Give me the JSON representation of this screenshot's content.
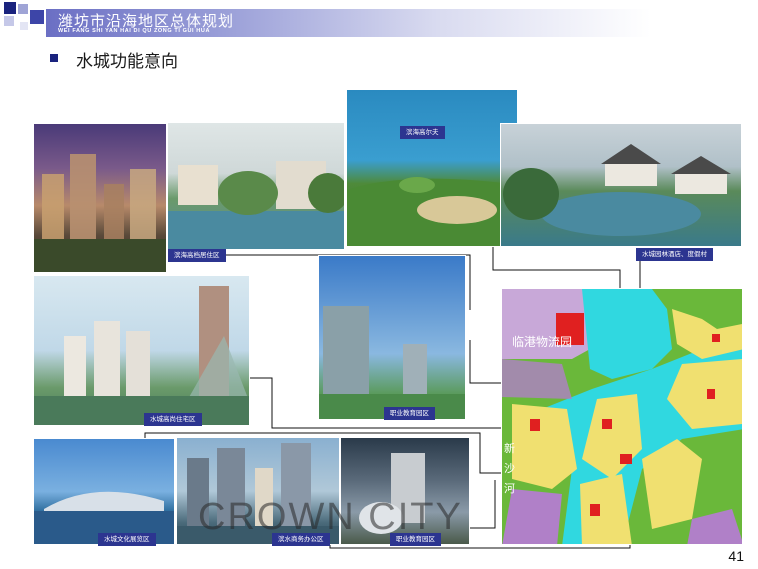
{
  "header": {
    "title": "潍坊市沿海地区总体规划",
    "subtitle": "WEI  FANG SHI YAN HAI  DI    QU ZONG  TI GUI  HUA"
  },
  "section": {
    "title": "水城功能意向"
  },
  "captions": {
    "golf": "滨海高尔夫",
    "lowrise": "滨海高档居住区",
    "resort": "水城园林酒店、度假村",
    "highrise": "水城高尚住宅区",
    "education_top": "职业教育园区",
    "culture": "水城文化展览区",
    "business": "滨水商务办公区",
    "education_bottom": "职业教育园区"
  },
  "map": {
    "logistics_label": "临港物流园",
    "river_label": "新　沙　河"
  },
  "watermark": "CROWN CITY",
  "page_number": "41",
  "colors": {
    "caption_bg": "#2c3590",
    "header_band": "#6b6fc4",
    "bullet": "#1a237e"
  }
}
